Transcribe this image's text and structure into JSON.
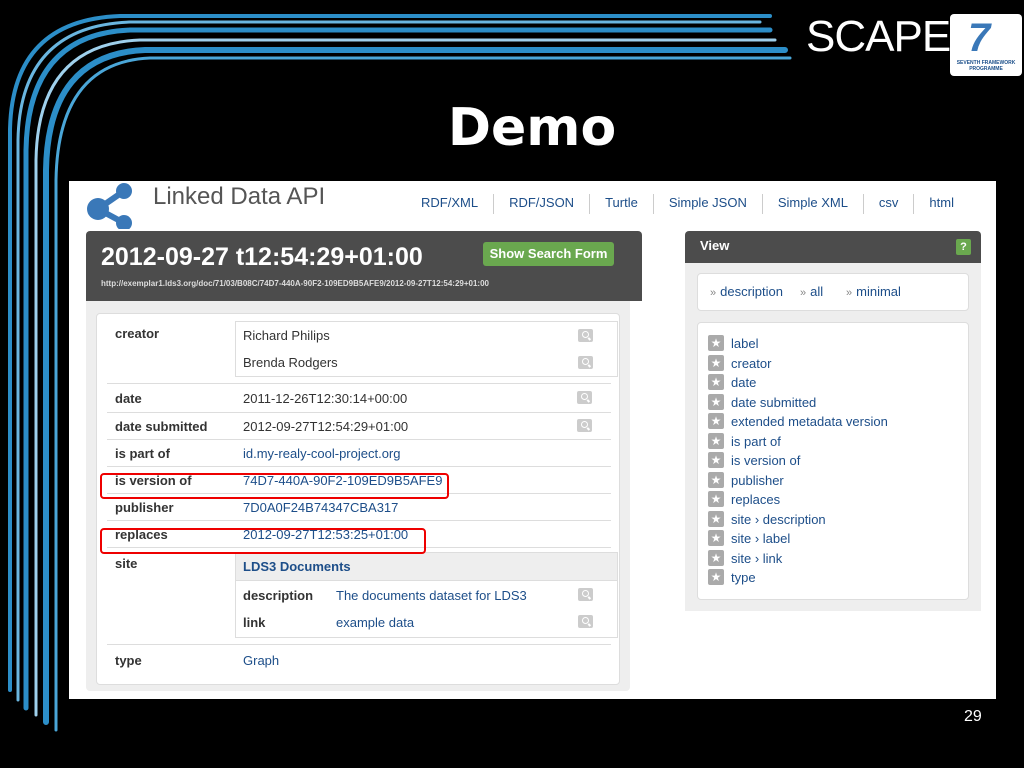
{
  "slide": {
    "brand": "SCAPE",
    "fp7_text": "SEVENTH FRAMEWORK PROGRAMME",
    "title": "Demo",
    "page_number": "29"
  },
  "app": {
    "name": "Linked Data API",
    "formats": [
      "RDF/XML",
      "RDF/JSON",
      "Turtle",
      "Simple JSON",
      "Simple XML",
      "csv",
      "html"
    ]
  },
  "resource": {
    "title": "2012-09-27 t12:54:29+01:00",
    "uri": "http://exemplar1.lds3.org/doc/71/03/B08C/74D7-440A-90F2-109ED9B5AFE9/2012-09-27T12:54:29+01:00",
    "search_button": "Show Search Form"
  },
  "properties": {
    "creator": {
      "label": "creator",
      "values": [
        "Richard Philips",
        "Brenda Rodgers"
      ]
    },
    "date": {
      "label": "date",
      "value": "2011-12-26T12:30:14+00:00"
    },
    "date_submitted": {
      "label": "date submitted",
      "value": "2012-09-27T12:54:29+01:00"
    },
    "is_part_of": {
      "label": "is part of",
      "value": "id.my-realy-cool-project.org"
    },
    "is_version_of": {
      "label": "is version of",
      "value": "74D7-440A-90F2-109ED9B5AFE9"
    },
    "publisher": {
      "label": "publisher",
      "value": "7D0A0F24B74347CBA317"
    },
    "replaces": {
      "label": "replaces",
      "value": "2012-09-27T12:53:25+01:00"
    },
    "site": {
      "label": "site",
      "name": "LDS3 Documents",
      "description_label": "description",
      "description_value": "The documents dataset for LDS3",
      "link_label": "link",
      "link_value": "example data"
    },
    "type": {
      "label": "type",
      "value": "Graph"
    }
  },
  "view": {
    "title": "View",
    "help": "?",
    "options": [
      "description",
      "all",
      "minimal"
    ],
    "fields": [
      "label",
      "creator",
      "date",
      "date submitted",
      "extended metadata version",
      "is part of",
      "is version of",
      "publisher",
      "replaces",
      "site › description",
      "site › label",
      "site › link",
      "type"
    ]
  },
  "colors": {
    "accent_green": "#6aa84f",
    "link_blue": "#1d4e89",
    "highlight_red": "#ee0000",
    "header_gray": "#4c4c4c"
  }
}
